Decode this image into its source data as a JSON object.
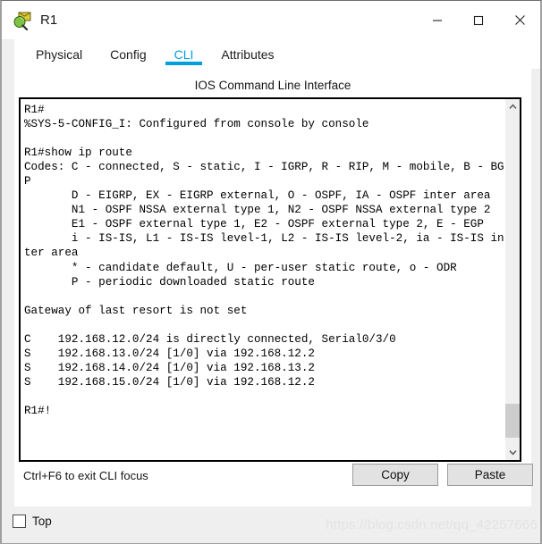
{
  "window": {
    "title": "R1",
    "icon": "router-magnifier-icon",
    "minimize_icon": "minimize-icon",
    "maximize_icon": "maximize-icon",
    "close_icon": "close-icon"
  },
  "tabs": [
    {
      "label": "Physical",
      "active": false
    },
    {
      "label": "Config",
      "active": false
    },
    {
      "label": "CLI",
      "active": true
    },
    {
      "label": "Attributes",
      "active": false
    }
  ],
  "panel": {
    "header": "IOS Command Line Interface"
  },
  "terminal": {
    "content": "R1#\n%SYS-5-CONFIG_I: Configured from console by console\n\nR1#show ip route\nCodes: C - connected, S - static, I - IGRP, R - RIP, M - mobile, B - BGP\n       D - EIGRP, EX - EIGRP external, O - OSPF, IA - OSPF inter area\n       N1 - OSPF NSSA external type 1, N2 - OSPF NSSA external type 2\n       E1 - OSPF external type 1, E2 - OSPF external type 2, E - EGP\n       i - IS-IS, L1 - IS-IS level-1, L2 - IS-IS level-2, ia - IS-IS inter area\n       * - candidate default, U - per-user static route, o - ODR\n       P - periodic downloaded static route\n\nGateway of last resort is not set\n\nC    192.168.12.0/24 is directly connected, Serial0/3/0\nS    192.168.13.0/24 [1/0] via 192.168.12.2\nS    192.168.14.0/24 [1/0] via 192.168.13.2\nS    192.168.15.0/24 [1/0] via 192.168.12.2\n\nR1#!"
  },
  "scrollbar": {
    "up_icon": "chevron-up-icon",
    "down_icon": "chevron-down-icon"
  },
  "controls": {
    "hint": "Ctrl+F6 to exit CLI focus",
    "copy_label": "Copy",
    "paste_label": "Paste"
  },
  "footer": {
    "top_checkbox_label": "Top",
    "top_checkbox_checked": false,
    "watermark": "https://blog.csdn.net/qq_42257666"
  },
  "colors": {
    "accent": "#00a0dc",
    "panel_bg": "#ffffff",
    "window_bg": "#efefef",
    "button_bg": "#e2e2e2",
    "scroll_thumb": "#cdcdcd"
  }
}
